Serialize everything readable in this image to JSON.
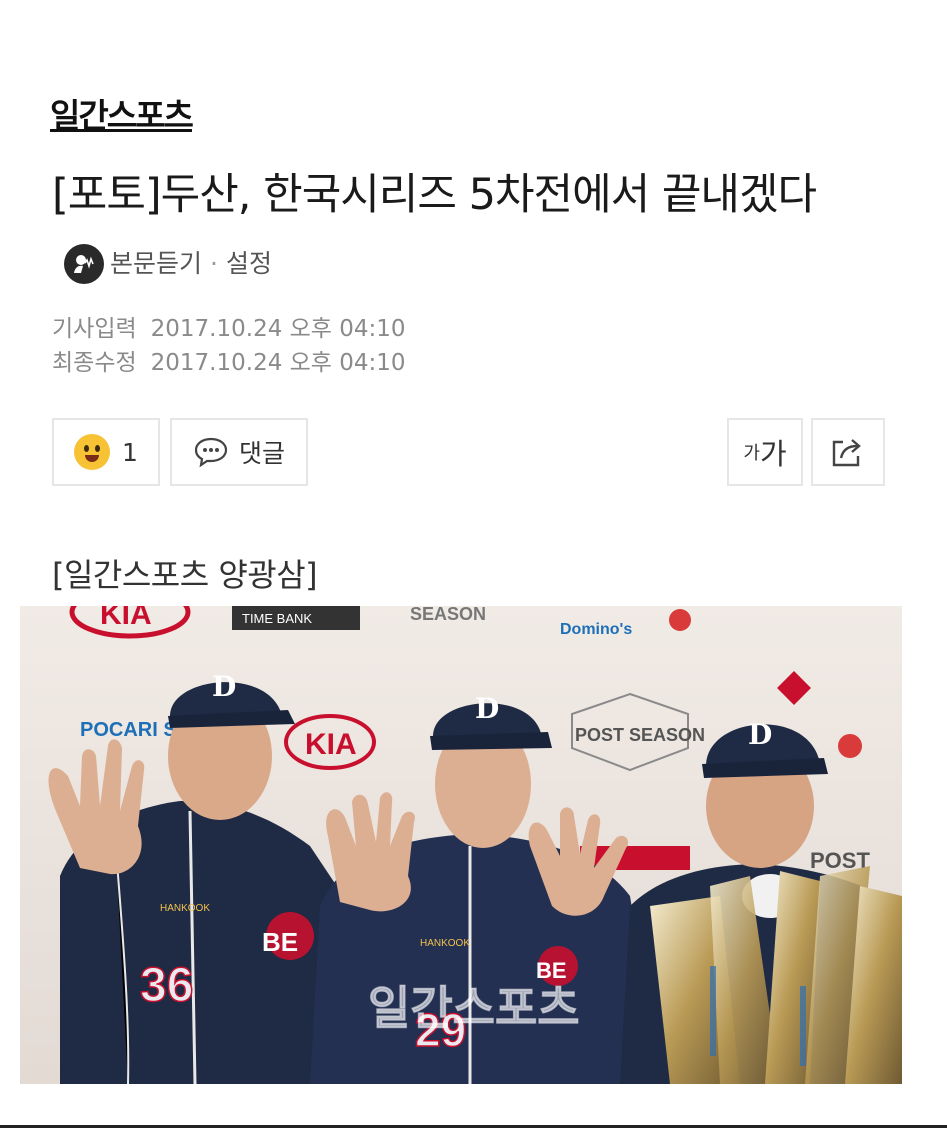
{
  "brand": "일간스포츠",
  "article": {
    "headline": "[포토]두산, 한국시리즈 5차전에서 끝내겠다",
    "tts": {
      "listen_label": "본문듣기",
      "separator": "·",
      "settings_label": "설정"
    },
    "published_label": "기사입력",
    "published_time": "2017.10.24 오후 04:10",
    "modified_label": "최종수정",
    "modified_time": "2017.10.24 오후 04:10"
  },
  "actions": {
    "reaction_count": "1",
    "comment_label": "댓글",
    "font_small": "가",
    "font_large": "가",
    "share_icon": "share-icon",
    "reaction_icon": "grinning-emoji-icon",
    "comment_icon": "speech-bubble-icon"
  },
  "photo": {
    "caption": "[일간스포츠 양광삼]",
    "watermark": "일간스포츠",
    "backdrop_texts": [
      "KIA",
      "TIME BANK",
      "SEASON",
      "Domino's",
      "POCARI SWEAT",
      "POST SEASON",
      "KIA",
      "POST"
    ],
    "jersey_numbers": [
      "36",
      "29"
    ],
    "cap_letter": "D",
    "jersey_texts": [
      "BE",
      "BE",
      "HANKOOK",
      "HANKOOK"
    ]
  },
  "colors": {
    "text": "#1a1a1a",
    "muted": "#8a8a8a",
    "border": "#e6e6e6",
    "uniform_navy": "#1f2a44",
    "emoji_yellow": "#f7c234"
  }
}
